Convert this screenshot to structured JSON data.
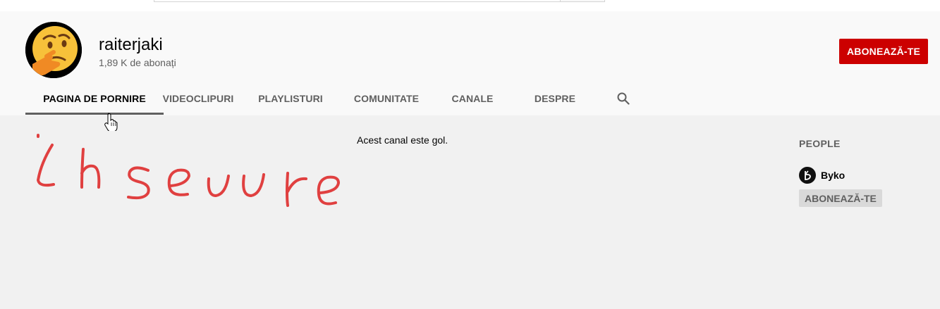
{
  "channel": {
    "name": "raiterjaki",
    "subscribers": "1,89 K de abonați",
    "subscribe_label": "ABONEAZĂ-TE"
  },
  "tabs": [
    {
      "label": "PAGINA DE PORNIRE",
      "active": true
    },
    {
      "label": "VIDEOCLIPURI",
      "active": false
    },
    {
      "label": "PLAYLISTURI",
      "active": false
    },
    {
      "label": "COMUNITATE",
      "active": false
    },
    {
      "label": "CANALE",
      "active": false
    },
    {
      "label": "DESPRE",
      "active": false
    }
  ],
  "search_icon": "search-icon",
  "main": {
    "empty_message": "Acest canal este gol.",
    "handwriting": "înseuure"
  },
  "people": {
    "title": "PEOPLE",
    "items": [
      {
        "name": "Byko",
        "subscribe_label": "ABONEAZĂ-TE"
      }
    ]
  },
  "colors": {
    "subscribe_red": "#cc0000",
    "scribble_red": "#e04040",
    "header_bg": "#f9f9f9",
    "page_bg": "#f1f1f1"
  }
}
